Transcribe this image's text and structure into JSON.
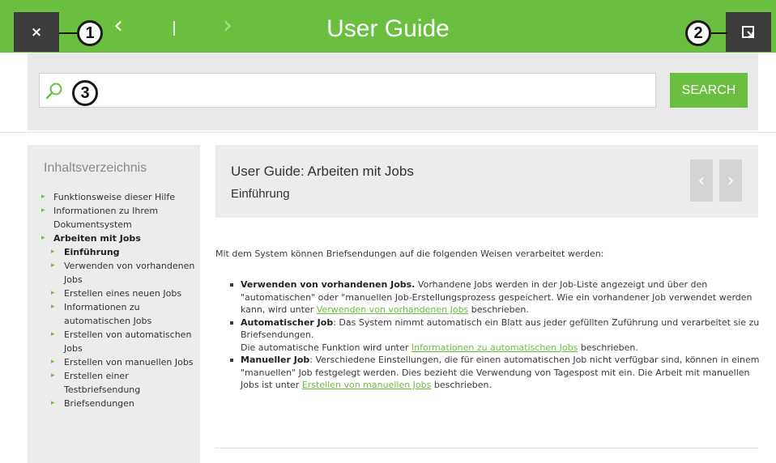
{
  "header": {
    "close_label": "×",
    "back_label": "‹",
    "forward_label": "›",
    "title": "User Guide"
  },
  "callouts": {
    "c1": "1",
    "c2": "2",
    "c3": "3"
  },
  "search": {
    "placeholder": "",
    "button_label": "SEARCH"
  },
  "sidebar": {
    "title": "Inhaltsverzeichnis",
    "items": [
      {
        "label": "Funktionsweise dieser Hilfe",
        "level": 1,
        "bold": false
      },
      {
        "label": "Informationen zu Ihrem Dokumentsystem",
        "level": 1,
        "bold": false
      },
      {
        "label": "Arbeiten mit Jobs",
        "level": 1,
        "bold": true
      },
      {
        "label": "Einführung",
        "level": 2,
        "bold": true
      },
      {
        "label": "Verwenden von vorhandenen Jobs",
        "level": 2,
        "bold": false
      },
      {
        "label": "Erstellen eines neuen Jobs",
        "level": 2,
        "bold": false
      },
      {
        "label": "Informationen zu automatischen Jobs",
        "level": 2,
        "bold": false
      },
      {
        "label": "Erstellen von automatischen Jobs",
        "level": 2,
        "bold": false
      },
      {
        "label": "Erstellen von manuellen Jobs",
        "level": 2,
        "bold": false
      },
      {
        "label": "Erstellen einer Testbriefsendung",
        "level": 2,
        "bold": false
      },
      {
        "label": "Briefsendungen",
        "level": 2,
        "bold": false
      }
    ]
  },
  "main": {
    "title": "User Guide: Arbeiten mit Jobs",
    "subtitle": "Einführung",
    "prev_label": "‹",
    "next_label": "›",
    "intro": "Mit dem System können Briefsendungen auf die folgenden Weisen verarbeitet werden:",
    "bullets": {
      "b1_bold": "Verwenden von vorhandenen Jobs.",
      "b1_text": " Vorhandene Jobs werden in der Job-Liste angezeigt und über den \"automatischen\" oder \"manuellen Job-Erstellungsprozess gespeichert. Wie ein vorhandener Job verwendet werden kann, wird unter ",
      "b1_link": "Verwenden von vorhandenen Jobs",
      "b1_tail": " beschrieben.",
      "b2_bold": "Automatischer Job",
      "b2_text": ": Das System nimmt automatisch ein Blatt aus jeder gefüllten Zuführung und verarbeitet sie zu Briefsendungen.",
      "b2_text2": "Die automatische Funktion wird unter ",
      "b2_link": "Informationen zu automatischen Jobs",
      "b2_tail": " beschrieben.",
      "b3_bold": "Manueller Job",
      "b3_text": ": Verschiedene Einstellungen, die für einen automatischen Job nicht verfügbar sind, können in einem \"manuellen\" Job festgelegt werden. Dies bezieht die Verwendung von Tagespost mit ein. Die Arbeit mit manuellen Jobs ist unter ",
      "b3_link": "Erstellen von manuellen Jobs",
      "b3_tail": " beschrieben."
    }
  },
  "colors": {
    "brand_green": "#6abf40",
    "dark_button": "#3c3c3c",
    "panel_gray": "#ececec"
  }
}
